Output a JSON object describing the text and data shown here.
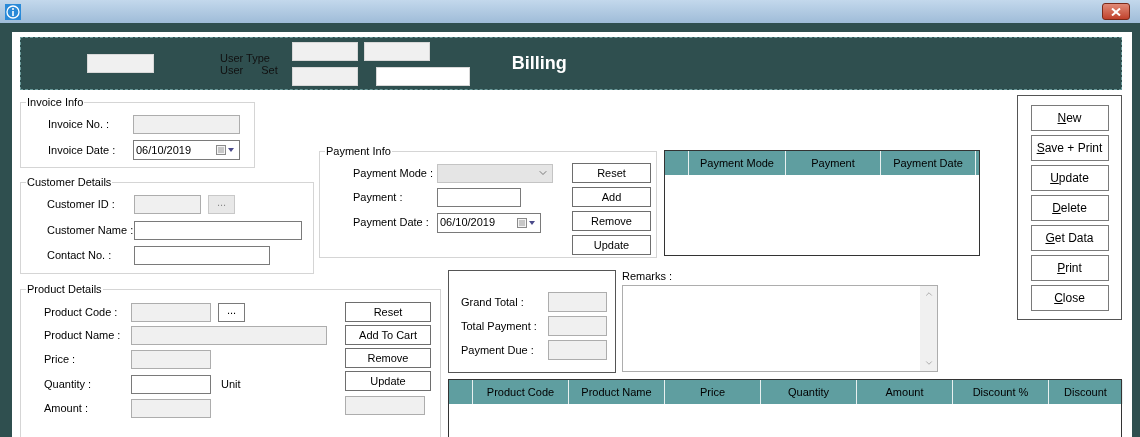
{
  "header": {
    "title": "Billing",
    "labels": [
      "User Type",
      "User",
      "Set"
    ],
    "fields": [
      {
        "disabled": true
      },
      {
        "disabled": true
      },
      {
        "disabled": true
      },
      {
        "disabled": true
      },
      {
        "disabled": false
      }
    ]
  },
  "invoice_info": {
    "legend": "Invoice Info",
    "rows": [
      {
        "kind": "text",
        "label": "Invoice No. :",
        "disabled": true
      },
      {
        "kind": "date",
        "label": "Invoice Date :",
        "value": "06/10/2019",
        "disabled": false
      }
    ]
  },
  "customer_details": {
    "legend": "Customer Details",
    "rows": [
      {
        "kind": "lookup",
        "label": "Customer ID :",
        "disabled": true,
        "button": "...",
        "button_disabled": true
      },
      {
        "kind": "text",
        "label": "Customer Name :",
        "disabled": false
      },
      {
        "kind": "text",
        "label": "Contact No. :",
        "disabled": false
      }
    ]
  },
  "payment_info": {
    "legend": "Payment Info",
    "rows": [
      {
        "kind": "combo",
        "label": "Payment Mode :",
        "disabled": true
      },
      {
        "kind": "text",
        "label": "Payment :",
        "disabled": false
      },
      {
        "kind": "date",
        "label": "Payment Date :",
        "value": "06/10/2019",
        "disabled": false
      }
    ],
    "buttons": [
      "Reset",
      "Add",
      "Remove",
      "Update"
    ]
  },
  "payment_table": {
    "columns": [
      "Payment Mode",
      "Payment",
      "Payment Date"
    ]
  },
  "product_details": {
    "legend": "Product Details",
    "rows": [
      {
        "kind": "lookup",
        "label": "Product Code :",
        "disabled": true,
        "button": "...",
        "button_disabled": false
      },
      {
        "kind": "text",
        "label": "Product Name :",
        "disabled": true
      },
      {
        "kind": "text",
        "label": "Price :",
        "disabled": true
      },
      {
        "kind": "text",
        "label": "Quantity :",
        "disabled": false,
        "unit": "Unit"
      },
      {
        "kind": "text",
        "label": "Amount :",
        "disabled": true
      }
    ],
    "buttons": [
      "Reset",
      "Add To Cart",
      "Remove",
      "Update"
    ],
    "extra_field": {
      "disabled": true
    }
  },
  "totals": {
    "rows": [
      {
        "label": "Grand Total :",
        "disabled": true
      },
      {
        "label": "Total Payment :",
        "disabled": true
      },
      {
        "label": "Payment Due :",
        "disabled": true
      }
    ]
  },
  "remarks": {
    "label": "Remarks :"
  },
  "product_table": {
    "columns": [
      "Product Code",
      "Product Name",
      "Price",
      "Quantity",
      "Amount",
      "Discount %",
      "Discount"
    ]
  },
  "actions": [
    {
      "label": "New",
      "underline_first": true
    },
    {
      "label": "Save + Print",
      "underline_first": true
    },
    {
      "label": "Update",
      "underline_first": true
    },
    {
      "label": "Delete",
      "underline_first": true
    },
    {
      "label": "Get Data",
      "underline_first": true
    },
    {
      "label": "Print",
      "underline_first": true
    },
    {
      "label": "Close",
      "underline_first": true
    }
  ]
}
